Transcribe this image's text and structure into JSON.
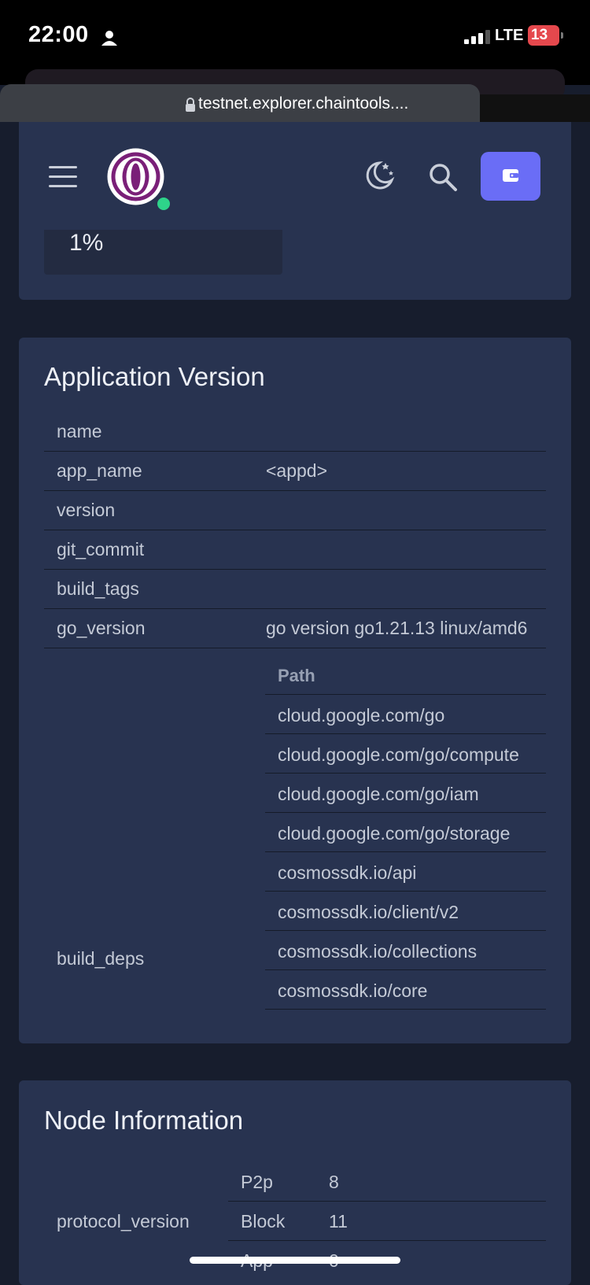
{
  "status_bar": {
    "time": "22:00",
    "network": "LTE",
    "battery": "13"
  },
  "browser": {
    "url": "testnet.explorer.chaintools...."
  },
  "header": {
    "icons": [
      "menu-icon",
      "chain-logo",
      "online-status-dot",
      "theme-toggle-icon",
      "search-icon",
      "wallet-icon"
    ],
    "progress_value": "1%"
  },
  "app_version": {
    "title": "Application Version",
    "rows": [
      {
        "label": "name",
        "value": ""
      },
      {
        "label": "app_name",
        "value": "<appd>"
      },
      {
        "label": "version",
        "value": ""
      },
      {
        "label": "git_commit",
        "value": ""
      },
      {
        "label": "build_tags",
        "value": ""
      },
      {
        "label": "go_version",
        "value": "go version go1.21.13 linux/amd6"
      }
    ],
    "build_deps": {
      "label": "build_deps",
      "column_header": "Path",
      "paths": [
        "cloud.google.com/go",
        "cloud.google.com/go/compute",
        "cloud.google.com/go/iam",
        "cloud.google.com/go/storage",
        "cosmossdk.io/api",
        "cosmossdk.io/client/v2",
        "cosmossdk.io/collections",
        "cosmossdk.io/core"
      ]
    }
  },
  "node_info": {
    "title": "Node Information",
    "protocol_version": {
      "label": "protocol_version",
      "items": [
        {
          "key": "P2p",
          "value": "8"
        },
        {
          "key": "Block",
          "value": "11"
        },
        {
          "key": "App",
          "value": "0"
        }
      ]
    }
  },
  "colors": {
    "accent": "#6a6df6",
    "online": "#2ed38a",
    "card": "#283350",
    "page": "#171d2d"
  }
}
